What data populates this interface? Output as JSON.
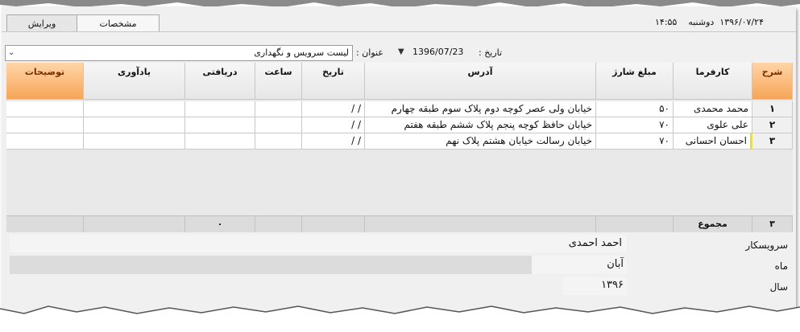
{
  "tabs": {
    "edit": "ویرایش",
    "properties": "مشخصات"
  },
  "status": {
    "time": "۱۴:۵۵",
    "day": "دوشنبه",
    "date": "۱۳۹۶/۰۷/۲۴"
  },
  "filters": {
    "date_label": "تاریخ :",
    "date_value": "1396/07/23",
    "title_label": "عنوان :",
    "title_value": "لیست سرویس و نگهداری"
  },
  "grid": {
    "headers": {
      "row": "شرح",
      "employer": "کارفرما",
      "charge": "مبلغ شارژ",
      "address": "آدرس",
      "date": "تاریخ",
      "time": "ساعت",
      "received": "دریافتی",
      "reminder": "یادآوری",
      "notes": "توضیحات"
    },
    "rows": [
      {
        "index": "۱",
        "employer": "محمد محمدی",
        "charge": "۵۰",
        "address": "خیابان ولی عصر کوچه دوم  پلاک سوم طبقه چهارم",
        "date": "/  /"
      },
      {
        "index": "۲",
        "employer": "علی علوی",
        "charge": "۷۰",
        "address": "خیابان حافظ کوچه پنجم پلاک ششم طبقه هفتم",
        "date": "/  /"
      },
      {
        "index": "۳",
        "employer": "احسان احسانی",
        "charge": "۷۰",
        "address": "خیابان رسالت خیابان هشتم پلاک نهم",
        "date": "/  /"
      }
    ],
    "summary": {
      "count": "۳",
      "label": "مجموع",
      "received_total": "۰"
    }
  },
  "form": {
    "technician_label": "سرویسکار",
    "technician_value": "احمد احمدی",
    "month_label": "ماه",
    "month_value": "آبان",
    "year_label": "سال",
    "year_value": "۱۳۹۶"
  },
  "colors": {
    "header_orange": "#f7a557",
    "selection_marker": "#f2e600"
  }
}
